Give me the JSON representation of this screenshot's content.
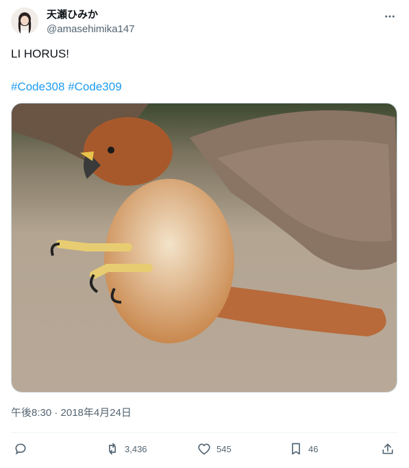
{
  "author": {
    "display_name": "天瀬ひみか",
    "handle": "@amasehimika147"
  },
  "tweet": {
    "text": "LI HORUS!",
    "hashtags": [
      "#Code308",
      "#Code309"
    ],
    "timestamp": "午後8:30 · 2018年4月24日",
    "media_description_icon": "hawk-photo"
  },
  "actions": {
    "reply_count": "",
    "retweet_count": "3,436",
    "like_count": "545",
    "bookmark_count": "46"
  },
  "colors": {
    "accent": "#1d9bf0",
    "secondary_text": "#536471",
    "divider": "#eff3f4"
  }
}
